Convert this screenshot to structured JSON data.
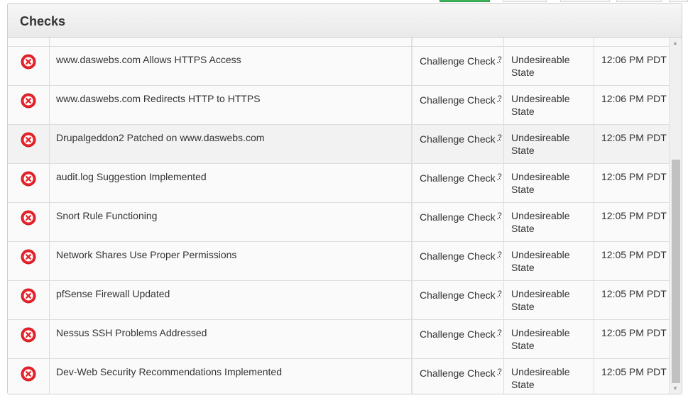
{
  "panel": {
    "title": "Checks"
  },
  "help_glyph": "?",
  "icons": {
    "status": "error-x-circle-icon",
    "scroll_up": "scroll-up-arrow-icon",
    "scroll_down": "scroll-down-arrow-icon"
  },
  "colors": {
    "error": "#e8232b",
    "accent_green": "#3cb35a"
  },
  "rows": [
    {
      "name": "www.daswebs.com Allows HTTPS Access",
      "type": "Challenge Check",
      "state": "Undesireable State",
      "time": "12:06 PM PDT"
    },
    {
      "name": "www.daswebs.com Redirects HTTP to HTTPS",
      "type": "Challenge Check",
      "state": "Undesireable State",
      "time": "12:06 PM PDT"
    },
    {
      "name": "Drupalgeddon2 Patched on www.daswebs.com",
      "type": "Challenge Check",
      "state": "Undesireable State",
      "time": "12:05 PM PDT"
    },
    {
      "name": "audit.log Suggestion Implemented",
      "type": "Challenge Check",
      "state": "Undesireable State",
      "time": "12:05 PM PDT"
    },
    {
      "name": "Snort Rule Functioning",
      "type": "Challenge Check",
      "state": "Undesireable State",
      "time": "12:05 PM PDT"
    },
    {
      "name": "Network Shares Use Proper Permissions",
      "type": "Challenge Check",
      "state": "Undesireable State",
      "time": "12:05 PM PDT"
    },
    {
      "name": "pfSense Firewall Updated",
      "type": "Challenge Check",
      "state": "Undesireable State",
      "time": "12:05 PM PDT"
    },
    {
      "name": "Nessus SSH Problems Addressed",
      "type": "Challenge Check",
      "state": "Undesireable State",
      "time": "12:05 PM PDT"
    },
    {
      "name": "Dev-Web Security Recommendations Implemented",
      "type": "Challenge Check",
      "state": "Undesireable State",
      "time": "12:05 PM PDT"
    }
  ]
}
